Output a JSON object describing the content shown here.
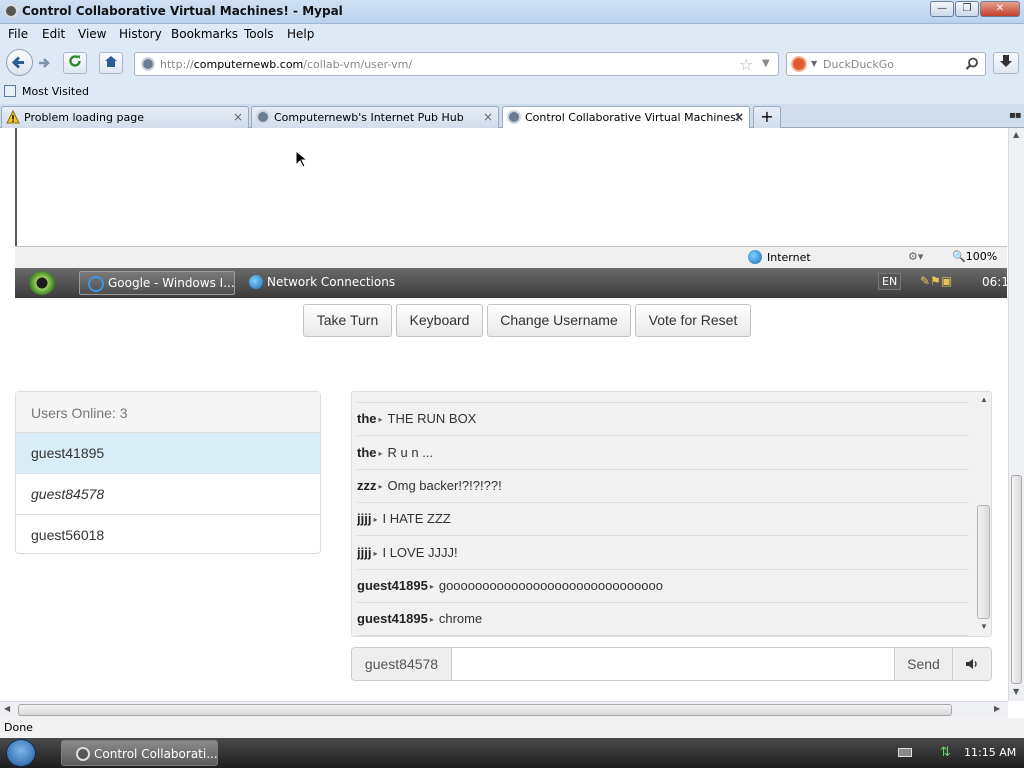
{
  "window": {
    "title": "Control Collaborative Virtual Machines! - Mypal",
    "minimize_glyph": "—",
    "maximize_glyph": "❐",
    "close_glyph": "✕"
  },
  "menu": {
    "items": [
      "File",
      "Edit",
      "View",
      "History",
      "Bookmarks",
      "Tools",
      "Help"
    ],
    "accelerators": [
      "F",
      "E",
      "V",
      "s",
      "B",
      "T",
      "H"
    ]
  },
  "navbar": {
    "back_icon": "back-arrow-icon",
    "forward_icon": "forward-arrow-icon",
    "reload_icon": "reload-icon",
    "home_icon": "home-icon",
    "url_prefix": "http://",
    "url_host": "computernewb.com",
    "url_path": "/collab-vm/user-vm/",
    "search_placeholder": "DuckDuckGo",
    "download_icon": "download-icon"
  },
  "bookmarks": {
    "most_visited": "Most Visited"
  },
  "tabs": [
    {
      "label": "Problem loading page",
      "icon": "warning-icon",
      "active": false
    },
    {
      "label": "Computernewb's Internet Pub Hub",
      "icon": "site-icon",
      "active": false
    },
    {
      "label": "Control Collaborative Virtual Machines!",
      "icon": "site-icon",
      "active": true
    }
  ],
  "tabs_new_glyph": "+",
  "close_glyph": "×",
  "vm": {
    "ie_status_zone": "Internet",
    "ie_zoom": "100%",
    "taskbar_items": [
      {
        "label": "Google - Windows I...",
        "icon": "ie-icon"
      },
      {
        "label": "Network Connections",
        "icon": "network-icon"
      }
    ],
    "language": "EN",
    "clock": "06:1"
  },
  "controls": {
    "take_turn": "Take Turn",
    "keyboard": "Keyboard",
    "change_username": "Change Username",
    "vote_reset": "Vote for Reset"
  },
  "users": {
    "header": "Users Online: 3",
    "list": [
      {
        "name": "guest41895",
        "selected": true,
        "me": false
      },
      {
        "name": "guest84578",
        "selected": false,
        "me": true
      },
      {
        "name": "guest56018",
        "selected": false,
        "me": false
      }
    ]
  },
  "chat": {
    "messages": [
      {
        "user": "the",
        "text": "THE RUN BOX"
      },
      {
        "user": "the",
        "text": "R u n ..."
      },
      {
        "user": "zzz",
        "text": "Omg backer!?!?!??!"
      },
      {
        "user": "jjjj",
        "text": "I HATE ZZZ"
      },
      {
        "user": "jjjj",
        "text": "I LOVE JJJJ!"
      },
      {
        "user": "guest41895",
        "text": "goooooooooooooooooooooooooooooo"
      },
      {
        "user": "guest41895",
        "text": "chrome"
      }
    ],
    "arrow": "▸",
    "username": "guest84578",
    "input_value": "",
    "send": "Send",
    "sound_icon": "speaker-icon"
  },
  "status": {
    "text": "Done"
  },
  "os_taskbar": {
    "task_label": "Control Collaborati...",
    "clock": "11:15 AM"
  }
}
